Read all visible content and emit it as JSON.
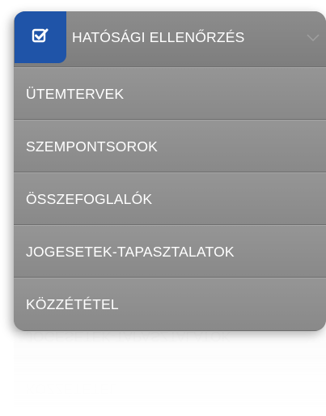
{
  "menu": {
    "header": {
      "label": "HATÓSÁGI ELLENŐRZÉS",
      "icon": "checkbox-icon",
      "chevron_icon": "chevron-down-icon",
      "accent_color": "#1f54a8"
    },
    "items": [
      {
        "label": "ÜTEMTERVEK"
      },
      {
        "label": "SZEMPONTSOROK"
      },
      {
        "label": "ÖSSZEFOGLALÓK"
      },
      {
        "label": "JOGESETEK-TAPASZTALATOK"
      },
      {
        "label": "KÖZZÉTÉTEL"
      }
    ]
  }
}
